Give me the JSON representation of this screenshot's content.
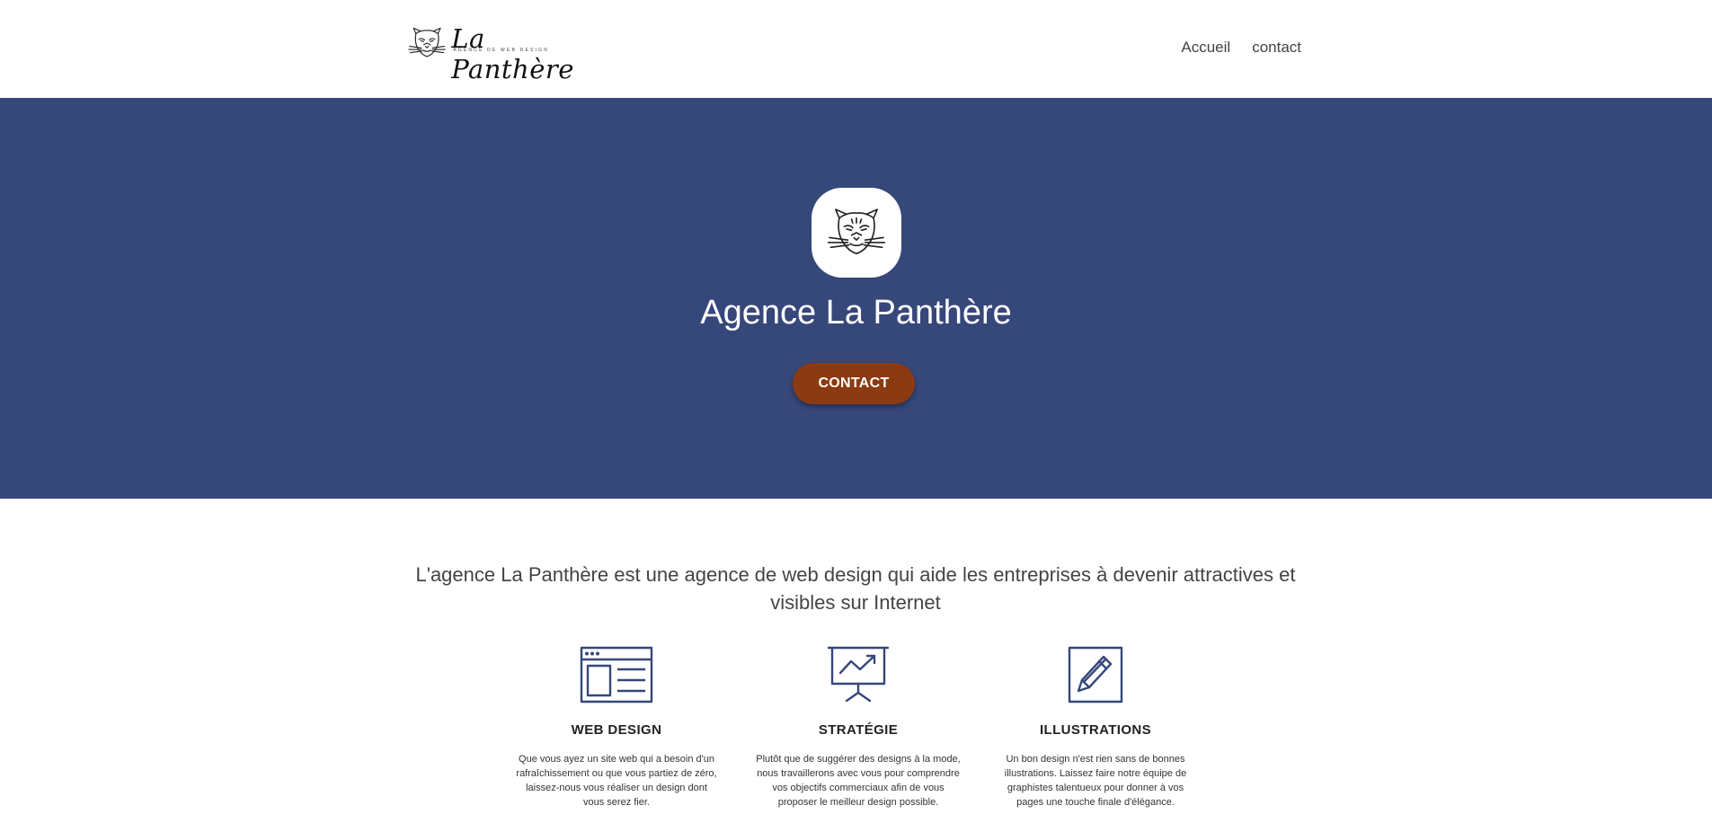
{
  "header": {
    "logo_title": "La Panthère",
    "logo_subtitle": "AGENCE DE WEB DESIGN",
    "logo_icon": "panther-head-icon",
    "nav": [
      {
        "label": "Accueil"
      },
      {
        "label": "contact"
      }
    ]
  },
  "hero": {
    "logo_icon": "panther-head-icon",
    "title": "Agence La Panthère",
    "button_label": "CONTACT",
    "background_color": "#36477a",
    "button_color": "#8b3a12"
  },
  "intro": {
    "text": "L'agence La Panthère est une agence de web design qui aide les entreprises à devenir attractives et visibles sur Internet"
  },
  "services": [
    {
      "icon": "web-layout-icon",
      "title": "WEB DESIGN",
      "description": "Que vous ayez un site web qui a besoin d'un rafraîchissement ou que vous partiez de zéro, laissez-nous vous réaliser un design dont vous serez fier."
    },
    {
      "icon": "presentation-chart-icon",
      "title": "STRATÉGIE",
      "description": "Plutôt que de suggérer des designs à la mode, nous travaillerons avec vous pour comprendre vos objectifs commerciaux afin de vous proposer le meilleur design possible."
    },
    {
      "icon": "pencil-icon",
      "title": "ILLUSTRATIONS",
      "description": "Un bon design n'est rien sans de bonnes illustrations. Laissez faire notre équipe de graphistes talentueux pour donner à vos pages une touche finale d'élégance."
    }
  ],
  "colors": {
    "icon_stroke": "#36477a"
  }
}
